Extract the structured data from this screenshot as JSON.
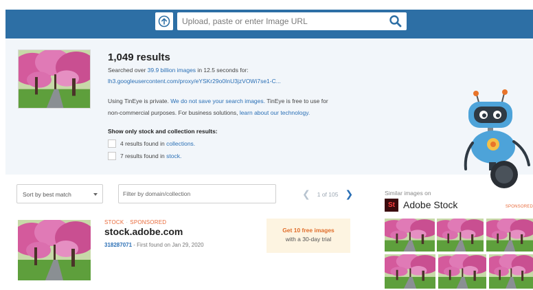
{
  "search": {
    "placeholder": "Upload, paste or enter Image URL"
  },
  "summary": {
    "results_count": "1,049 results",
    "searched_prefix": "Searched over ",
    "searched_link": "39.9 billion images",
    "searched_suffix": " in 12.5 seconds for:",
    "query_url": "lh3.googleusercontent.com/proxy/eYSKr29o0InU3jzVOWi7se1-C...",
    "privacy_prefix": "Using TinEye is private. ",
    "privacy_link": "We do not save your search images.",
    "privacy_suffix": " TinEye is free to use for",
    "commercial_prefix": "non-commercial purposes. For business solutions, ",
    "commercial_link": "learn about our technology.",
    "stock_heading": "Show only stock and collection results:",
    "filters": [
      {
        "prefix": "4 results found in ",
        "link": "collections."
      },
      {
        "prefix": "7 results found in ",
        "link": "stock."
      }
    ]
  },
  "controls": {
    "sort_label": "Sort by best match",
    "filter_placeholder": "Filter by domain/collection",
    "pager_text": "1 of 105"
  },
  "result": {
    "tag_stock": "STOCK",
    "tag_sponsored": "SPONSORED",
    "domain": "stock.adobe.com",
    "image_id": "318287071",
    "found_text": " - First found on Jan 29, 2020",
    "promo_line1": "Get 10 free images",
    "promo_line2": "with a 30-day trial"
  },
  "similar": {
    "label": "Similar images on",
    "brand_mark": "St",
    "brand_name": "Adobe Stock",
    "sponsored": "SPONSORED"
  },
  "colors": {
    "header_blue": "#2d6fa5",
    "link_blue": "#2a6fb5",
    "accent_orange": "#e86a3a",
    "summary_bg": "#f2f6fa"
  },
  "icons": [
    "upload-icon",
    "search-icon",
    "chevron-left-icon",
    "chevron-right-icon",
    "dropdown-arrow-icon"
  ]
}
